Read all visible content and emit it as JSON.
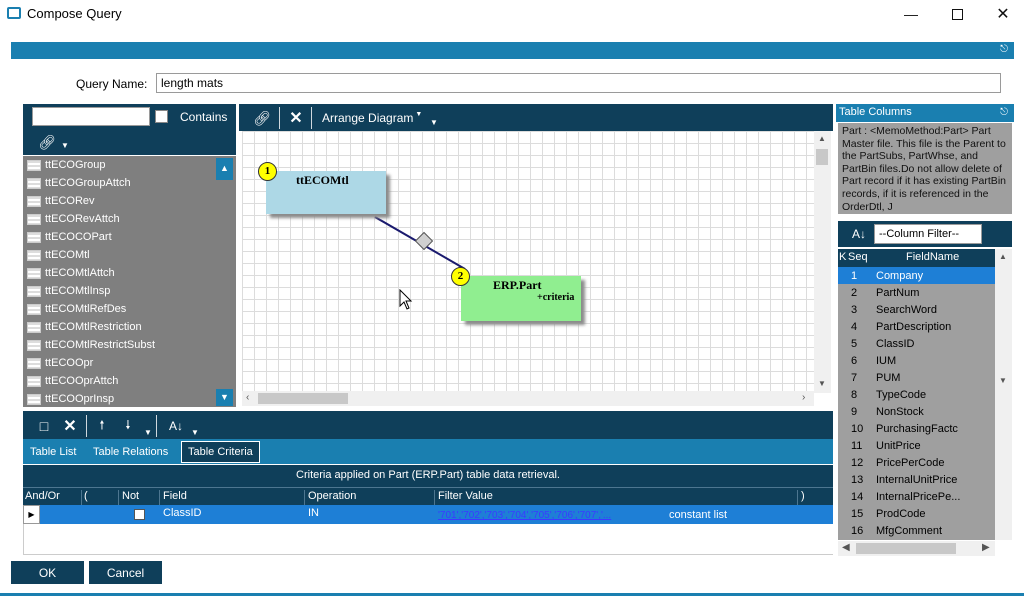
{
  "window": {
    "title": "Compose Query"
  },
  "query": {
    "label": "Query Name:",
    "value": "length mats"
  },
  "left_panel": {
    "search_value": "",
    "contains_label": "Contains",
    "tables": [
      "ttECOGroup",
      "ttECOGroupAttch",
      "ttECORev",
      "ttECORevAttch",
      "ttECOCOPart",
      "ttECOMtl",
      "ttECOMtlAttch",
      "ttECOMtlInsp",
      "ttECOMtlRefDes",
      "ttECOMtlRestriction",
      "ttECOMtlRestrictSubst",
      "ttECOOpr",
      "ttECOOprAttch",
      "ttECOOprInsp"
    ]
  },
  "diagram": {
    "toolbar": {
      "arrange_label": "Arrange Diagram"
    },
    "nodes": [
      {
        "number": "1",
        "name": "ttECOMtl",
        "sub": ""
      },
      {
        "number": "2",
        "name": "ERP.Part",
        "sub": "+criteria"
      }
    ]
  },
  "tabs": [
    "Table List",
    "Table Relations",
    "Table Criteria"
  ],
  "active_tab": "Table Criteria",
  "criteria": {
    "caption": "Criteria applied on Part (ERP.Part)  table data retrieval.",
    "headers": {
      "andor": "And/Or",
      "open": "(",
      "not": "Not",
      "field": "Field",
      "operation": "Operation",
      "filter": "Filter Value",
      "close": ")"
    },
    "rows": [
      {
        "andor": "",
        "open": "",
        "not": false,
        "field": "ClassID",
        "operation": "IN",
        "filter_link": "'701','702','703','704','705','706','707','...",
        "filter_suffix": "constant list",
        "close": ""
      }
    ]
  },
  "table_columns": {
    "title": "Table Columns",
    "description": "Part : <MemoMethod:Part> Part Master file. This file is the Parent to the PartSubs, PartWhse, and PartBin files.Do not allow delete of Part record if it has existing PartBin records, if it is referenced in the OrderDtl, J",
    "filter_placeholder": "--Column Filter--",
    "headers": {
      "k": "K",
      "seq": "Seq",
      "field": "FieldName"
    },
    "rows": [
      {
        "seq": "1",
        "name": "Company"
      },
      {
        "seq": "2",
        "name": "PartNum"
      },
      {
        "seq": "3",
        "name": "SearchWord"
      },
      {
        "seq": "4",
        "name": "PartDescription"
      },
      {
        "seq": "5",
        "name": "ClassID"
      },
      {
        "seq": "6",
        "name": "IUM"
      },
      {
        "seq": "7",
        "name": "PUM"
      },
      {
        "seq": "8",
        "name": "TypeCode"
      },
      {
        "seq": "9",
        "name": "NonStock"
      },
      {
        "seq": "10",
        "name": "PurchasingFactc"
      },
      {
        "seq": "11",
        "name": "UnitPrice"
      },
      {
        "seq": "12",
        "name": "PricePerCode"
      },
      {
        "seq": "13",
        "name": "InternalUnitPrice"
      },
      {
        "seq": "14",
        "name": "InternalPricePe..."
      },
      {
        "seq": "15",
        "name": "ProdCode"
      },
      {
        "seq": "16",
        "name": "MfgComment"
      }
    ]
  },
  "buttons": {
    "ok": "OK",
    "cancel": "Cancel"
  },
  "colors": {
    "blue": "#1a7fb0",
    "dark": "#0f3f5a",
    "gray_panel": "#7f7f7f",
    "selected": "#1e7fd6",
    "node1": "#add8e6",
    "node2": "#90ee90"
  }
}
